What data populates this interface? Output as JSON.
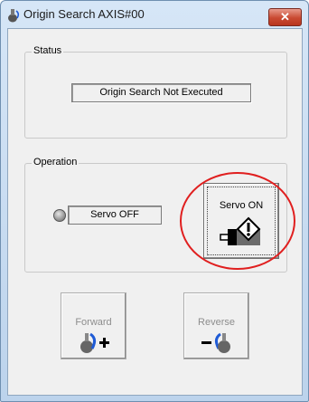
{
  "window": {
    "title": "Origin Search AXIS#00",
    "close_glyph": "✕"
  },
  "status": {
    "group_label": "Status",
    "value": "Origin Search Not Executed"
  },
  "operation": {
    "group_label": "Operation",
    "servo_state": "Servo OFF",
    "servo_button_label": "Servo ON"
  },
  "buttons": {
    "forward_label": "Forward",
    "reverse_label": "Reverse"
  },
  "colors": {
    "highlight_ring": "#e01f1f",
    "arrow_blue": "#1f5bd6"
  },
  "icons": [
    "motor-icon",
    "close-icon",
    "led-indicator",
    "servo-on-icon",
    "forward-icon",
    "reverse-icon"
  ]
}
